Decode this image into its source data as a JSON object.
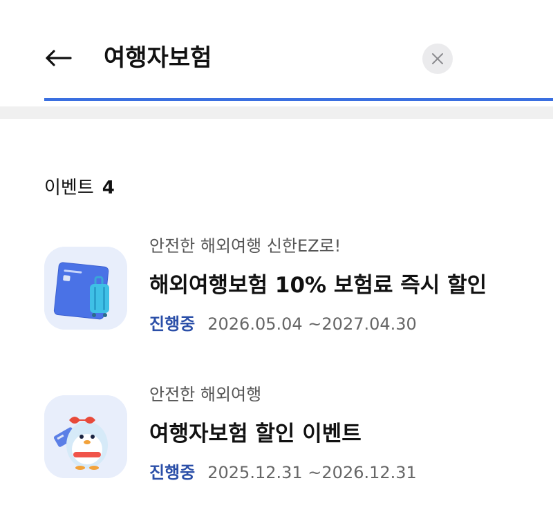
{
  "search": {
    "query": "여행자보험",
    "back_icon": "arrow-left-icon",
    "clear_icon": "close-icon",
    "accent_color": "#3a6fe0"
  },
  "section": {
    "title": "이벤트",
    "count": "4"
  },
  "events": [
    {
      "subtitle": "안전한 해외여행 신한EZ로!",
      "title": "해외여행보험 10% 보험료 즉시 할인",
      "status": "진행중",
      "dates": "2026.05.04 ~2027.04.30",
      "thumbnail_icon": "card-suitcase-icon"
    },
    {
      "subtitle": "안전한 해외여행",
      "title": "여행자보험 할인 이벤트",
      "status": "진행중",
      "dates": "2025.12.31 ~2026.12.31",
      "thumbnail_icon": "mascot-traveler-icon"
    }
  ],
  "colors": {
    "status": "#2b4fa8",
    "thumb_bg": "#e8eefb"
  }
}
